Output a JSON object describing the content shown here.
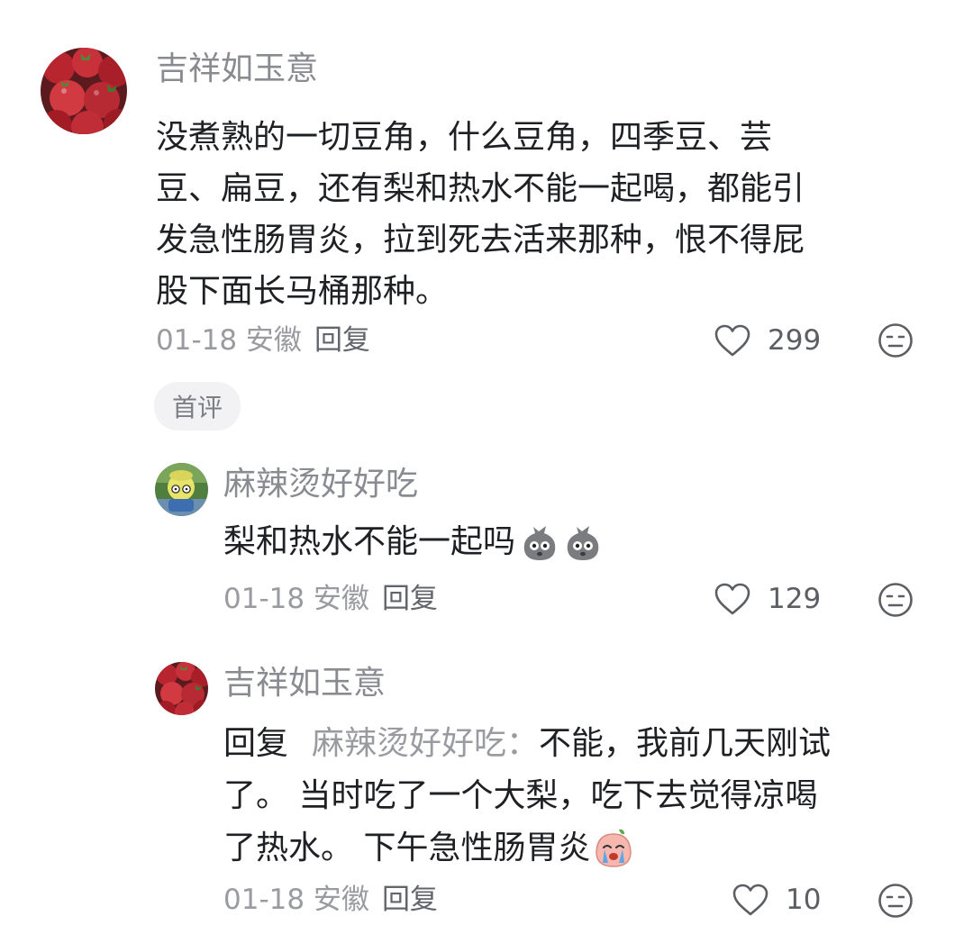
{
  "comments": [
    {
      "username": "吉祥如玉意",
      "lines": [
        "没煮熟的一切豆角，什么豆角，四季豆、芸",
        "豆、扁豆，还有梨和热水不能一起喝，都能引",
        "发急性肠胃炎，拉到死去活来那种，恨不得屁",
        "股下面长马桶那种。"
      ],
      "date_location": "01-18 安徽",
      "reply_label": "回复",
      "likes": "299",
      "tag": "首评"
    }
  ],
  "replies": [
    {
      "username": "麻辣烫好好吃",
      "text": "梨和热水不能一起吗",
      "date_location": "01-18 安徽",
      "reply_label": "回复",
      "likes": "129"
    },
    {
      "username": "吉祥如玉意",
      "reply_prefix": "回复",
      "mention": "麻辣烫好好吃：",
      "line1_rest": "不能，我前几天刚试",
      "line2": "了。 当时吃了一个大梨，吃下去觉得凉喝",
      "line3": "了热水。 下午急性肠胃炎",
      "date_location": "01-18 安徽",
      "reply_label": "回复",
      "likes": "10"
    }
  ],
  "icons": {
    "like": "heart-outline-icon",
    "dislike": "meh-face-icon",
    "emoji_1": "sack-face-emoji",
    "emoji_2": "crying-peach-emoji"
  },
  "colors": {
    "username": "#8a8b90",
    "meta": "#9a9ba0",
    "text": "#1f2024",
    "tag_bg": "#f2f2f4"
  }
}
